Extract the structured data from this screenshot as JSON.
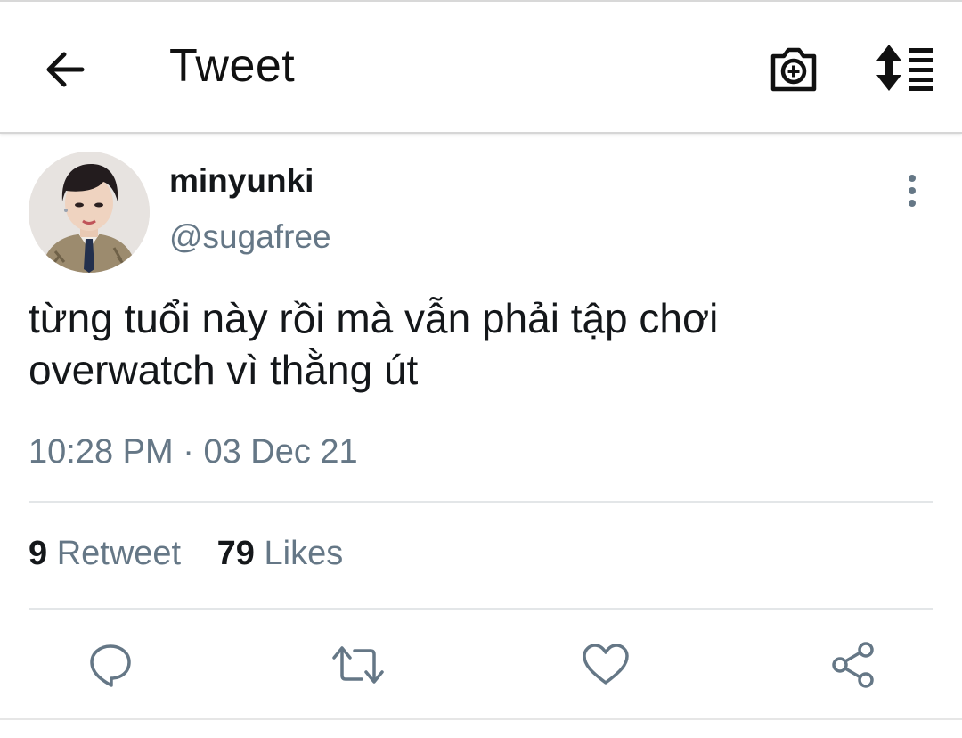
{
  "header": {
    "title": "Tweet",
    "back_icon": "arrow-left-icon",
    "camera_icon": "camera-plus-icon",
    "sort_icon": "sort-list-icon"
  },
  "tweet": {
    "author": {
      "display_name": "minyunki",
      "handle": "@sugafree"
    },
    "text_line1": "từng tuổi này rồi mà vẫn phải tập chơi",
    "text_line2": "overwatch vì thằng út",
    "time": "10:28 PM",
    "separator": "·",
    "date": "03 Dec 21"
  },
  "stats": {
    "retweets_count": "9",
    "retweets_label": "Retweet",
    "likes_count": "79",
    "likes_label": "Likes"
  },
  "actions": [
    "reply-icon",
    "retweet-icon",
    "like-icon",
    "share-icon"
  ],
  "colors": {
    "text": "#14171a",
    "secondary": "#657786",
    "divider": "#e3e6e8"
  }
}
